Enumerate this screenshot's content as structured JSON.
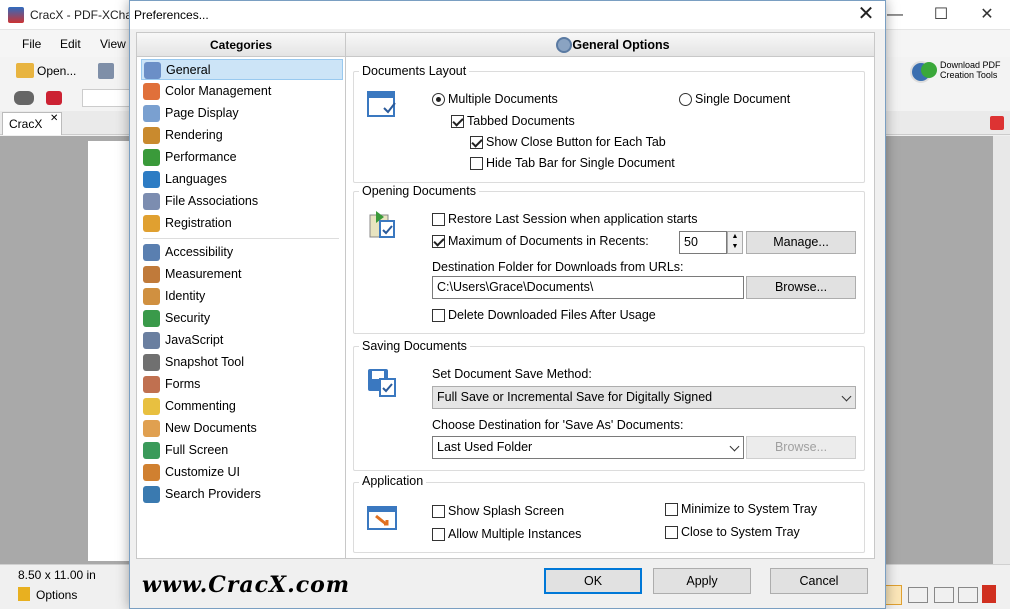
{
  "app": {
    "title": "CracX - PDF-XChar",
    "menu": [
      "File",
      "Edit",
      "View"
    ],
    "open_label": "Open...",
    "doc_tab": "CracX",
    "download_label_1": "Download PDF",
    "download_label_2": "Creation Tools",
    "page_size": "8.50 x 11.00 in",
    "options_label": "Options",
    "minimize": "—",
    "maximize": "☐",
    "close": "✕"
  },
  "dialog": {
    "title": "Preferences...",
    "close": "✕",
    "categories_header": "Categories",
    "categories": [
      {
        "label": "General",
        "icon": "general-icon",
        "color": "#6b8fc7"
      },
      {
        "label": "Color Management",
        "icon": "color-management-icon",
        "color": "#e0703a"
      },
      {
        "label": "Page Display",
        "icon": "page-display-icon",
        "color": "#7aa0d0"
      },
      {
        "label": "Rendering",
        "icon": "rendering-icon",
        "color": "#c98a2e"
      },
      {
        "label": "Performance",
        "icon": "performance-icon",
        "color": "#3a9a3a"
      },
      {
        "label": "Languages",
        "icon": "languages-icon",
        "color": "#2d7cc4"
      },
      {
        "label": "File Associations",
        "icon": "file-associations-icon",
        "color": "#7c8db0"
      },
      {
        "label": "Registration",
        "icon": "registration-icon",
        "color": "#e0a030"
      },
      {
        "label": "Accessibility",
        "icon": "accessibility-icon",
        "color": "#5a7fb0"
      },
      {
        "label": "Measurement",
        "icon": "measurement-icon",
        "color": "#c07a3a"
      },
      {
        "label": "Identity",
        "icon": "identity-icon",
        "color": "#d09040"
      },
      {
        "label": "Security",
        "icon": "security-icon",
        "color": "#3a9a4a"
      },
      {
        "label": "JavaScript",
        "icon": "javascript-icon",
        "color": "#6a7fa0"
      },
      {
        "label": "Snapshot Tool",
        "icon": "snapshot-tool-icon",
        "color": "#707070"
      },
      {
        "label": "Forms",
        "icon": "forms-icon",
        "color": "#c07050"
      },
      {
        "label": "Commenting",
        "icon": "commenting-icon",
        "color": "#e8c040"
      },
      {
        "label": "New Documents",
        "icon": "new-documents-icon",
        "color": "#e0a050"
      },
      {
        "label": "Full Screen",
        "icon": "full-screen-icon",
        "color": "#3a9a5a"
      },
      {
        "label": "Customize UI",
        "icon": "customize-ui-icon",
        "color": "#d08030"
      },
      {
        "label": "Search Providers",
        "icon": "search-providers-icon",
        "color": "#3a7ab0"
      }
    ],
    "main_header": "General Options",
    "documents_layout": {
      "label": "Documents Layout",
      "multiple": "Multiple Documents",
      "single": "Single Document",
      "tabbed": "Tabbed Documents",
      "show_close": "Show Close Button for Each Tab",
      "hide_tab_bar": "Hide Tab Bar for Single Document"
    },
    "opening_documents": {
      "label": "Opening Documents",
      "restore": "Restore Last Session when application starts",
      "max_docs": "Maximum of Documents in Recents:",
      "max_value": "50",
      "manage": "Manage...",
      "dest_label": "Destination Folder for Downloads from URLs:",
      "dest_value": "C:\\Users\\Grace\\Documents\\",
      "browse": "Browse...",
      "delete_after": "Delete Downloaded Files After Usage"
    },
    "saving_documents": {
      "label": "Saving Documents",
      "method_label": "Set Document Save Method:",
      "method_value": "Full Save or Incremental Save for Digitally Signed",
      "dest_label": "Choose Destination for 'Save As' Documents:",
      "dest_value": "Last Used Folder",
      "browse": "Browse..."
    },
    "application": {
      "label": "Application",
      "splash": "Show Splash Screen",
      "multiple_instances": "Allow Multiple Instances",
      "minimize_tray": "Minimize to System Tray",
      "close_tray": "Close to System Tray"
    },
    "buttons": {
      "ok": "OK",
      "apply": "Apply",
      "cancel": "Cancel"
    }
  },
  "watermark": "www.CracX.com"
}
